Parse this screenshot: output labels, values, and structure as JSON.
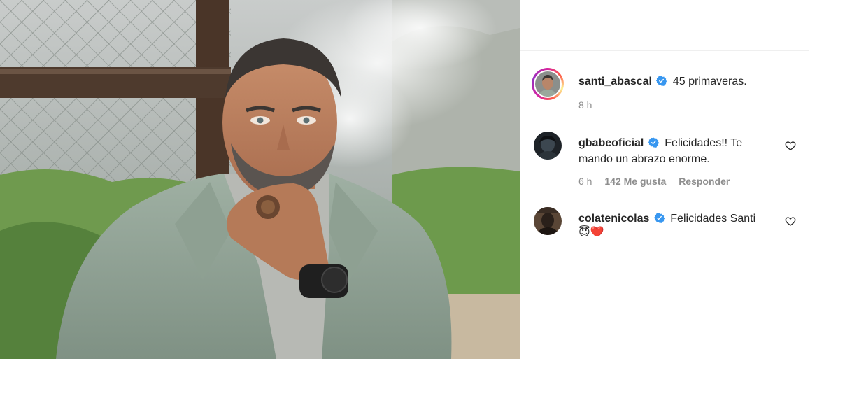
{
  "post": {
    "caption": {
      "username": "santi_abascal",
      "text": "45 primaveras.",
      "time": "8 h"
    }
  },
  "comments": [
    {
      "username": "gbabeoficial",
      "text": "Felicidades!! Te mando un abrazo enorme.",
      "time": "6 h",
      "likes": "142 Me gusta",
      "reply": "Responder"
    },
    {
      "username": "colatenicolas",
      "text": "Felicidades Santi",
      "emojis": "😇❤️"
    }
  ],
  "icons": {
    "verified": "verified-badge-icon",
    "like": "heart-outline-icon"
  },
  "colors": {
    "verified_blue": "#3897f0",
    "muted": "#8e8e8e",
    "text": "#262626",
    "story_ring_from": "#d6249f",
    "story_ring_to": "#fd5949"
  }
}
